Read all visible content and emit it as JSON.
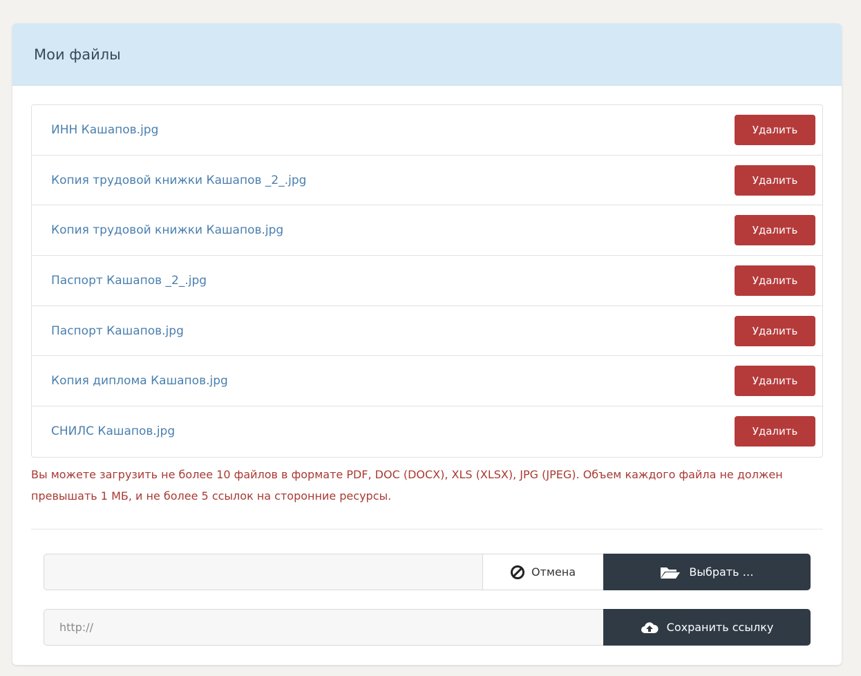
{
  "panel": {
    "title": "Мои файлы"
  },
  "files": [
    {
      "name": "ИНН Кашапов.jpg",
      "delete_label": "Удалить"
    },
    {
      "name": "Копия трудовой книжки Кашапов _2_.jpg",
      "delete_label": "Удалить"
    },
    {
      "name": "Копия трудовой книжки Кашапов.jpg",
      "delete_label": "Удалить"
    },
    {
      "name": "Паспорт Кашапов _2_.jpg",
      "delete_label": "Удалить"
    },
    {
      "name": "Паспорт Кашапов.jpg",
      "delete_label": "Удалить"
    },
    {
      "name": "Копия диплома Кашапов.jpg",
      "delete_label": "Удалить"
    },
    {
      "name": "СНИЛС Кашапов.jpg",
      "delete_label": "Удалить"
    }
  ],
  "notice": "Вы можете загрузить не более 10 файлов в формате PDF, DOC (DOCX), XLS (XLSX), JPG (JPEG). Объем каждого файла не должен превышать 1 МБ, и не более 5 ссылок на сторонние ресурсы.",
  "upload": {
    "file_value": "",
    "cancel_label": "Отмена",
    "cancel_icon": "ban-icon",
    "browse_label": "Выбрать …",
    "browse_icon": "folder-open-icon"
  },
  "link": {
    "placeholder": "http://",
    "value": "",
    "save_label": "Сохранить ссылку",
    "save_icon": "cloud-upload-icon"
  },
  "colors": {
    "header_bg": "#d4e9f5",
    "link": "#4a7fae",
    "danger": "#b53a3a",
    "notice": "#a83a33",
    "dark_button": "#2f3a45"
  }
}
